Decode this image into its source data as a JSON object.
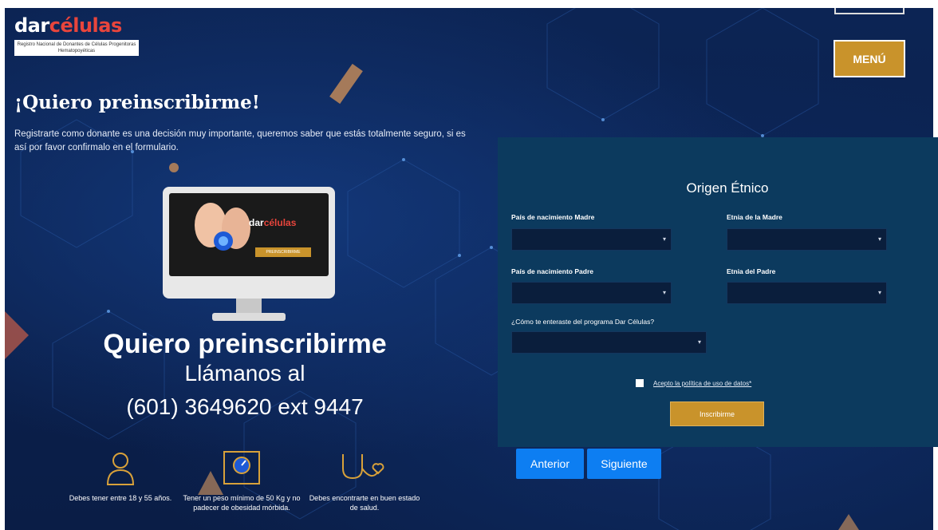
{
  "header": {
    "logo_part1": "dar",
    "logo_part2": "células",
    "logo_subtitle": "Registro Nacional de Donantes de Células Progenitoras Hematopoyéticas",
    "menu_label": "MENÚ"
  },
  "hero": {
    "title": "¡Quiero preinscribirme!",
    "intro": "Registrarte como donante es una decisión muy importante, queremos saber que estás totalmente seguro, si es así por favor confirmalo en el formulario.",
    "big_title": "Quiero preinscribirme",
    "call_label": "Llámanos al",
    "phone": "(601) 3649620 ext 9447",
    "monitor_logo_part1": "dar",
    "monitor_logo_part2": "células",
    "monitor_button": "PREINSCRIBIRME"
  },
  "features": [
    {
      "icon": "person-icon",
      "text": "Debes tener entre 18 y 55 años."
    },
    {
      "icon": "scale-icon",
      "text": "Tener un peso mínimo de 50 Kg y no padecer de obesidad mórbida."
    },
    {
      "icon": "stethoscope-heart-icon",
      "text": "Debes encontrarte en buen estado de salud."
    }
  ],
  "form": {
    "section_title": "Origen Étnico",
    "mother_country_label": "País de nacimiento Madre",
    "mother_ethnicity_label": "Etnia de la Madre",
    "father_country_label": "País de nacimiento Padre",
    "father_ethnicity_label": "Etnia del Padre",
    "source_label": "¿Cómo te enteraste del programa Dar Células?",
    "policy_label": "Acepto la política de uso de datos*",
    "submit_label": "Inscribirme"
  },
  "navigation": {
    "previous_label": "Anterior",
    "next_label": "Siguiente"
  },
  "colors": {
    "background": "#0a1f4a",
    "panel": "#0c3a5e",
    "accent_gold": "#c9932b",
    "primary_blue": "#0d7ef2",
    "logo_red": "#e8453c"
  }
}
